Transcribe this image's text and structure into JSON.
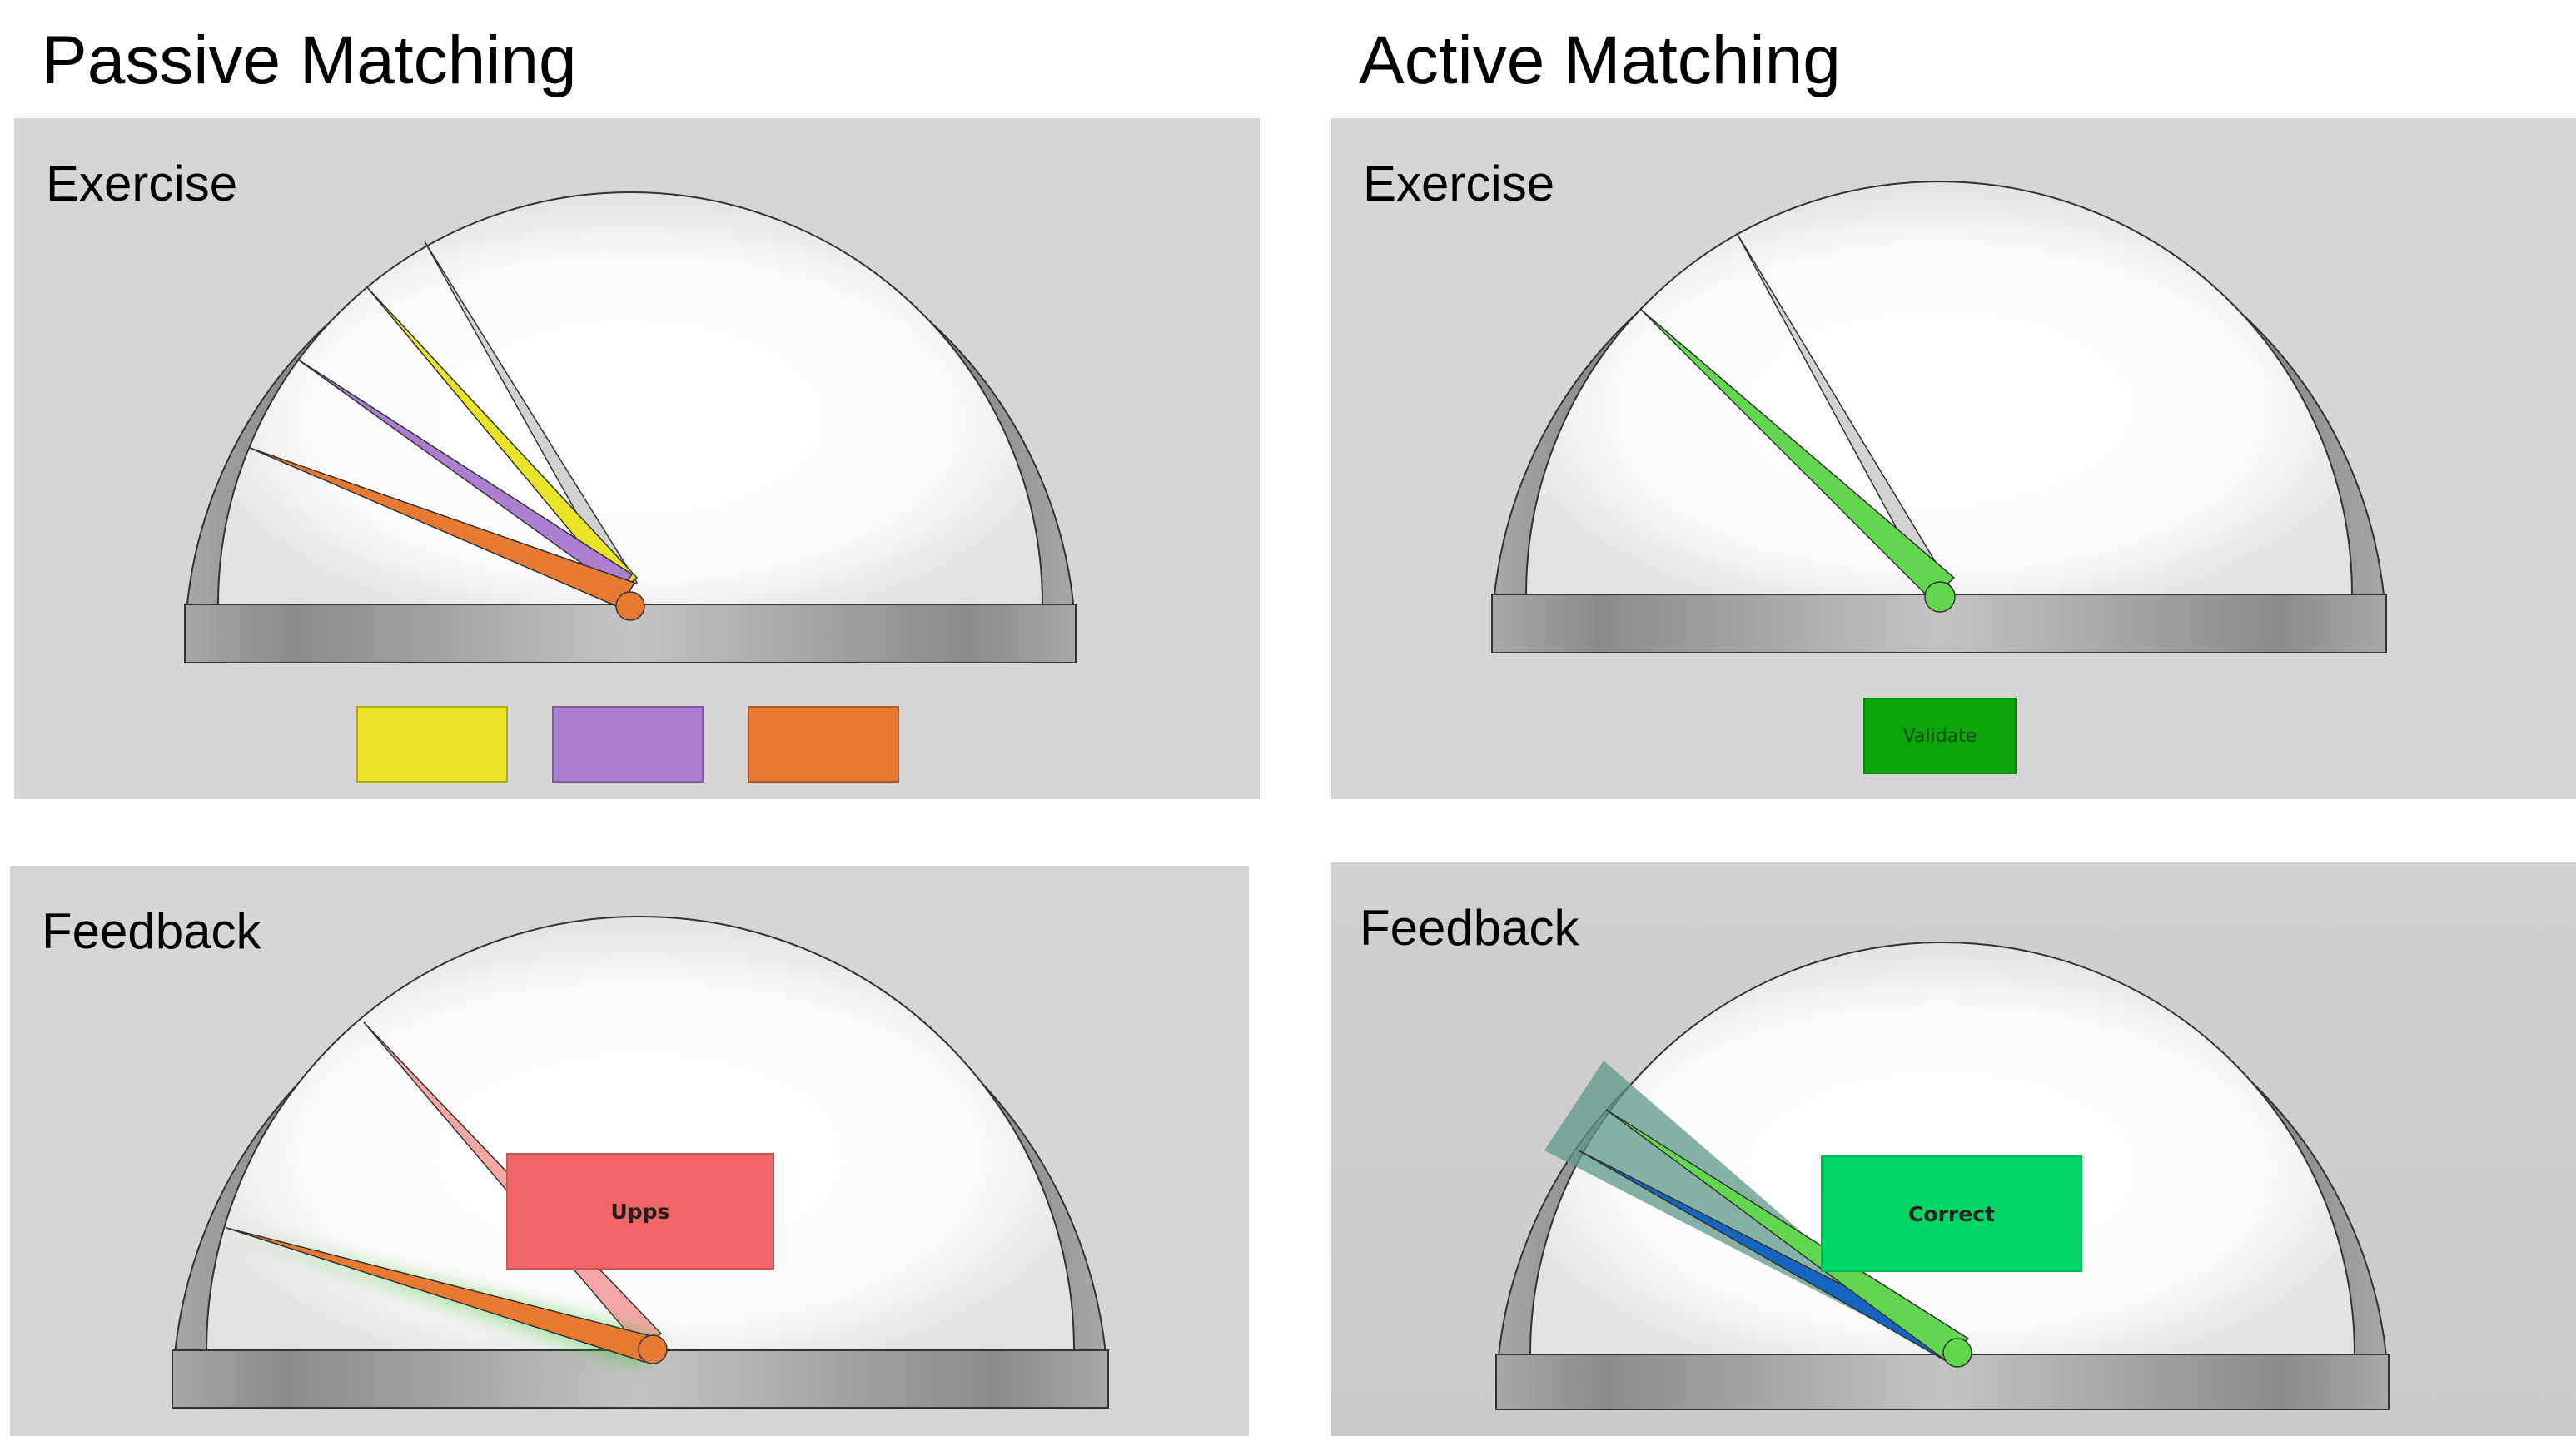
{
  "headings": {
    "passive": "Passive Matching",
    "active": "Active Matching"
  },
  "panels": {
    "passive_exercise": {
      "label": "Exercise",
      "answer_options": [
        {
          "color": "#e8e428",
          "name": "yellow"
        },
        {
          "color": "#ab7ed0",
          "name": "purple"
        },
        {
          "color": "#e67a32",
          "name": "orange"
        }
      ]
    },
    "active_exercise": {
      "label": "Exercise",
      "button_label": "Validate",
      "button_color": "#0aa60a"
    },
    "passive_feedback": {
      "label": "Feedback",
      "message": "Upps",
      "message_color": "#f06566"
    },
    "active_feedback": {
      "label": "Feedback",
      "message": "Correct",
      "message_color": "#00d566"
    }
  },
  "colors": {
    "panel_bg": "#d6d6d6",
    "needle_gray": "#d2d2d2",
    "needle_yellow": "#e8e428",
    "needle_purple": "#ab7ed0",
    "needle_orange": "#e67a32",
    "needle_green": "#62d64e",
    "needle_blue": "#1565c0",
    "needle_pink": "#f4a6a6",
    "target_zone": "#5e9a8a"
  }
}
